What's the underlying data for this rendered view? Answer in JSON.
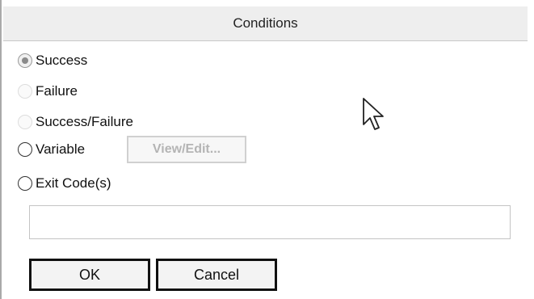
{
  "dialog": {
    "title": "Conditions"
  },
  "options": [
    {
      "label": "Success",
      "state": "checked-disabled"
    },
    {
      "label": "Failure",
      "state": "disabled"
    },
    {
      "label": "Success/Failure",
      "state": "disabled"
    },
    {
      "label": "Variable",
      "state": "enabled"
    },
    {
      "label": "Exit Code(s)",
      "state": "enabled"
    }
  ],
  "variable": {
    "view_edit_label": "View/Edit..."
  },
  "exit_codes": {
    "value": ""
  },
  "buttons": {
    "ok_label": "OK",
    "cancel_label": "Cancel"
  },
  "cursor": {
    "icon": "mouse-pointer-icon"
  }
}
